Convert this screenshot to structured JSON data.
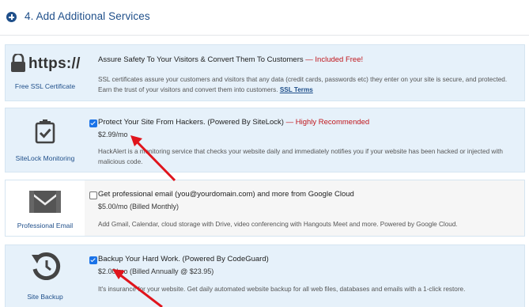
{
  "header": {
    "title": "4. Add Additional Services"
  },
  "services": [
    {
      "caption": "Free SSL Certificate",
      "icon_text": "https://",
      "title": "Assure Safety To Your Visitors & Convert Them To Customers",
      "sep": " — ",
      "badge": "Included Free!",
      "description": "SSL certificates assure your customers and visitors that any data (credit cards, passwords etc) they enter on your site is secure, and protected. Earn the trust of your visitors and convert them into customers.",
      "link": "SSL Terms"
    },
    {
      "caption": "SiteLock Monitoring",
      "icon": "shield-check-icon",
      "checked": true,
      "title": "Protect Your Site From Hackers. (Powered By SiteLock)",
      "sep": " — ",
      "badge": "Highly Recommended",
      "price": "$2.99/mo",
      "description": "HackAlert is a monitoring service that checks your website daily and immediately notifies you if your website has been hacked or injected with malicious code."
    },
    {
      "caption": "Professional Email",
      "icon": "envelope-icon",
      "checked": false,
      "title": "Get professional email (you@yourdomain.com) and more from Google Cloud",
      "price": "$5.00/mo (Billed Monthly)",
      "description": "Add Gmail, Calendar, cloud storage with Drive, video conferencing with Hangouts Meet and more. Powered by Google Cloud."
    },
    {
      "caption": "Site Backup",
      "icon": "backup-clock-icon",
      "checked": true,
      "title": "Backup Your Hard Work. (Powered By CodeGuard)",
      "price": "$2.00/mo (Billed Annually @ $23.95)",
      "description": "It's insurance for your website. Get daily automated website backup for all web files, databases and emails with a 1-click restore."
    }
  ],
  "colors": {
    "accent": "#1f4f8a",
    "highlight": "#c0161c",
    "active_bg": "#e6f1fa",
    "annotation_arrow": "#e0141c"
  }
}
